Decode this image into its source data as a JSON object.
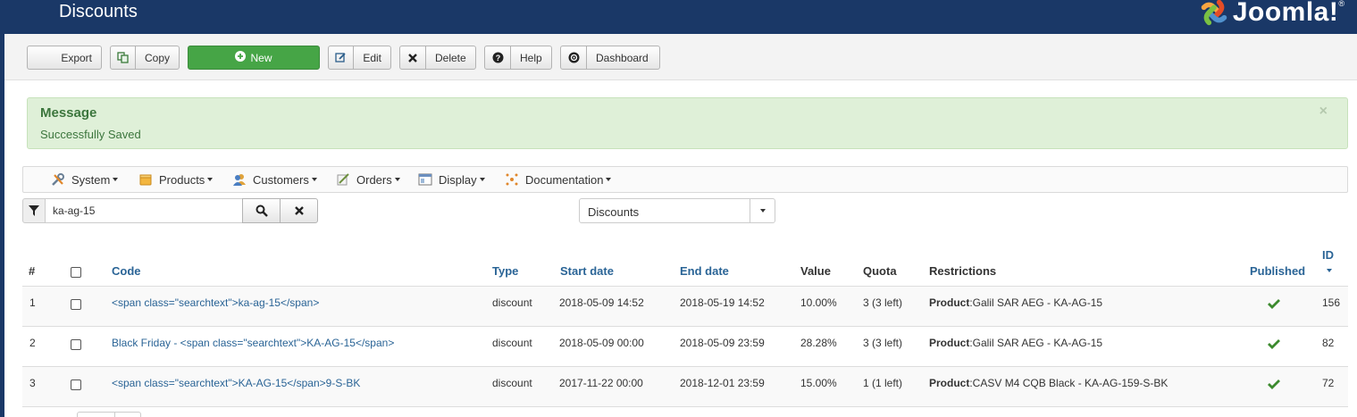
{
  "header": {
    "title": "Discounts",
    "logo_text": "Joomla!",
    "logo_reg": "®",
    "colors": {
      "background": "#1a3867",
      "logo_red": "#e44d26",
      "logo_orange": "#f9a541",
      "logo_green": "#7ac143",
      "logo_blue": "#5091cd"
    }
  },
  "toolbar": {
    "export_label": "Export",
    "copy_label": "Copy",
    "new_label": "New",
    "edit_label": "Edit",
    "delete_label": "Delete",
    "help_label": "Help",
    "dashboard_label": "Dashboard",
    "colors": {
      "new": "#46a546"
    }
  },
  "message": {
    "heading": "Message",
    "text": "Successfully Saved",
    "close": "×",
    "colors": {
      "background": "#dff0d8",
      "text": "#3c763d"
    }
  },
  "menu": {
    "items": [
      {
        "label": "System",
        "icon": "tools-icon"
      },
      {
        "label": "Products",
        "icon": "box-icon"
      },
      {
        "label": "Customers",
        "icon": "users-icon"
      },
      {
        "label": "Orders",
        "icon": "edit-icon"
      },
      {
        "label": "Display",
        "icon": "display-icon"
      },
      {
        "label": "Documentation",
        "icon": "documentation-icon"
      }
    ]
  },
  "filter": {
    "search_value": "ka-ag-15",
    "type_selected": "Discounts"
  },
  "table": {
    "headers": {
      "num": "#",
      "code": "Code",
      "type": "Type",
      "start": "Start date",
      "end": "End date",
      "value": "Value",
      "quota": "Quota",
      "restrictions": "Restrictions",
      "published": "Published",
      "id": "ID"
    },
    "rows": [
      {
        "num": "1",
        "code": "<span class=\"searchtext\">ka-ag-15</span>",
        "type": "discount",
        "start": "2018-05-09 14:52",
        "end": "2018-05-19 14:52",
        "value": "10.00%",
        "quota": "3 (3 left)",
        "restriction_label": "Product",
        "restriction_value": ":Galil SAR AEG - KA-AG-15",
        "published": true,
        "id": "156"
      },
      {
        "num": "2",
        "code": "Black Friday - <span class=\"searchtext\">KA-AG-15</span>",
        "type": "discount",
        "start": "2018-05-09 00:00",
        "end": "2018-05-09 23:59",
        "value": "28.28%",
        "quota": "3 (3 left)",
        "restriction_label": "Product",
        "restriction_value": ":Galil SAR AEG - KA-AG-15",
        "published": true,
        "id": "82"
      },
      {
        "num": "3",
        "code": "<span class=\"searchtext\">KA-AG-15</span>9-S-BK",
        "type": "discount",
        "start": "2017-11-22 00:00",
        "end": "2018-12-01 23:59",
        "value": "15.00%",
        "quota": "1 (1 left)",
        "restriction_label": "Product",
        "restriction_value": ":CASV M4 CQB Black - KA-AG-159-S-BK",
        "published": true,
        "id": "72"
      }
    ],
    "colors": {
      "link": "#2a6496",
      "published_check": "#3c8a2e"
    }
  }
}
